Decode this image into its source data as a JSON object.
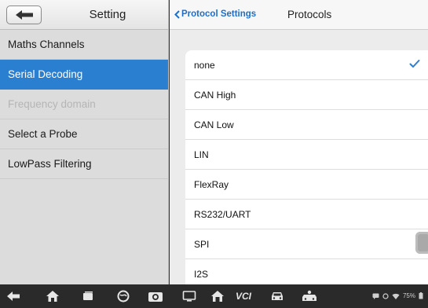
{
  "left_panel": {
    "title": "Setting",
    "items": [
      {
        "label": "Maths Channels"
      },
      {
        "label": "Serial Decoding"
      },
      {
        "label": "Frequency domain"
      },
      {
        "label": "Select a Probe"
      },
      {
        "label": "LowPass Filtering"
      }
    ]
  },
  "right_panel": {
    "breadcrumb": "Protocol Settings",
    "title": "Protocols",
    "protocols": [
      {
        "label": "none",
        "selected": true
      },
      {
        "label": "CAN High"
      },
      {
        "label": "CAN Low"
      },
      {
        "label": "LIN"
      },
      {
        "label": "FlexRay"
      },
      {
        "label": "RS232/UART"
      },
      {
        "label": "SPI"
      },
      {
        "label": "I2S"
      }
    ]
  },
  "bottom_bar": {
    "vci_label": "VCI",
    "battery_text": "75%"
  },
  "colors": {
    "accent": "#2a7fd0",
    "breadcrumb": "#1f6fc8"
  }
}
